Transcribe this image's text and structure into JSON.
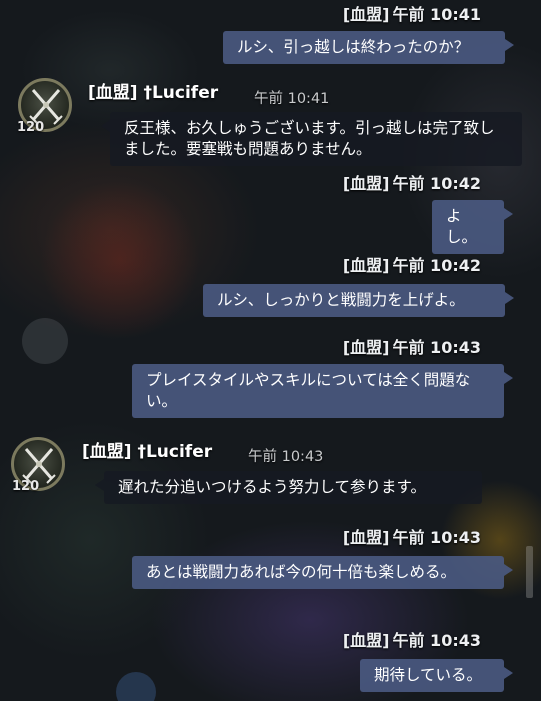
{
  "messages": [
    {
      "guild_tag": "[血盟]",
      "time": "午前 10:41",
      "text": "ルシ、引っ越しは終わったのか？"
    },
    {
      "sender": "[血盟] †Lucifer",
      "level": "120",
      "time": "午前 10:41",
      "text": "反王様、お久しゅうございます。引っ越しは完了致しました。要塞戦も問題ありません。"
    },
    {
      "guild_tag": "[血盟]",
      "time": "午前 10:42",
      "text": "よし。"
    },
    {
      "guild_tag": "[血盟]",
      "time": "午前 10:42",
      "text": "ルシ、しっかりと戦闘力を上げよ。"
    },
    {
      "guild_tag": "[血盟]",
      "time": "午前 10:43",
      "text": "プレイスタイルやスキルについては全く問題ない。"
    },
    {
      "sender": "[血盟] †Lucifer",
      "level": "120",
      "time": "午前 10:43",
      "text": "遅れた分追いつけるよう努力して参ります。"
    },
    {
      "guild_tag": "[血盟]",
      "time": "午前 10:43",
      "text": "あとは戦闘力あれば今の何十倍も楽しめる。"
    },
    {
      "guild_tag": "[血盟]",
      "time": "午前 10:43",
      "text": "期待している。"
    }
  ],
  "icons": {
    "avatar": "crossed-swords-icon"
  },
  "colors": {
    "own_bubble": "#4a5a82",
    "other_bubble": "#161a22",
    "avatar_border": "#7c7a5e"
  }
}
